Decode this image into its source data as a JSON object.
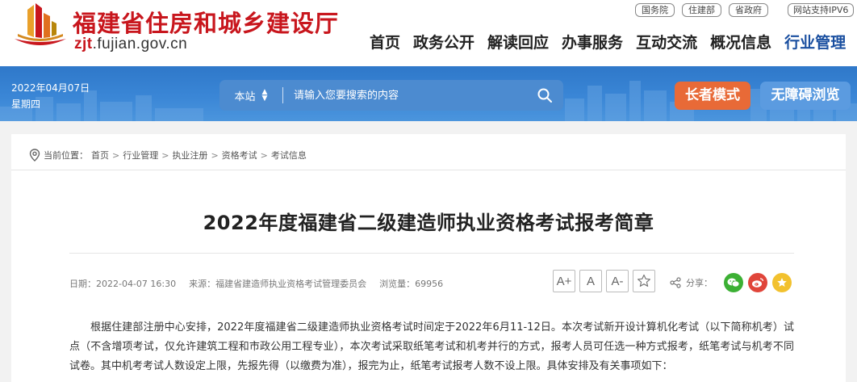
{
  "header": {
    "site_title": "福建省住房和城乡建设厅",
    "domain_prefix": "zjt",
    "domain_suffix": ".fujian.gov.cn",
    "top_links": [
      "国务院",
      "住建部",
      "省政府"
    ],
    "ipv6_badge": "网站支持IPV6",
    "nav": [
      "首页",
      "政务公开",
      "解读回应",
      "办事服务",
      "互动交流",
      "概况信息",
      "行业管理"
    ],
    "active_nav": "行业管理"
  },
  "banner": {
    "date": "2022年04月07日",
    "weekday": "星期四",
    "search_scope": "本站",
    "search_placeholder": "请输入您要搜索的内容",
    "elder_mode": "长者模式",
    "accessible_mode": "无障碍浏览"
  },
  "breadcrumb": {
    "prefix": "当前位置：",
    "items": [
      "首页",
      "行业管理",
      "执业注册",
      "资格考试",
      "考试信息"
    ],
    "separator": ">"
  },
  "article": {
    "title": "2022年度福建省二级建造师执业资格考试报考简章",
    "date": "日期：2022-04-07 16:30",
    "source": "来源：福建省建造师执业资格考试管理委员会",
    "views": "浏览量：69956",
    "font_larger": "A+",
    "font_normal": "A",
    "font_smaller": "A-",
    "share_label": "分享：",
    "body": "根据住建部注册中心安排，2022年度福建省二级建造师执业资格考试时间定于2022年6月11-12日。本次考试新开设计算机化考试（以下简称机考）试点（不含增项考试，仅允许建筑工程和市政公用工程专业），本次考试采取纸笔考试和机考并行的方式，报考人员可任选一种方式报考，纸笔考试与机考不同试卷。其中机考考试人数设定上限，先报先得（以缴费为准），报完为止，纸笔考试报考人数不设上限。具体安排及有关事项如下："
  },
  "colors": {
    "brand_red": "#c8161d",
    "nav_active": "#1a4fa0",
    "banner_blue": "#3a86d6",
    "elder_orange": "#e86a37",
    "accessible_blue": "#5b9be0",
    "wechat_green": "#3cb034",
    "weibo_red": "#e0453a",
    "favorite_yellow": "#f2c12e"
  },
  "icons": {
    "logo": "building-logo-icon",
    "search": "search-icon",
    "location": "location-pin-icon",
    "favorite": "star-outline-icon",
    "share": "share-icon",
    "wechat": "wechat-icon",
    "weibo": "weibo-icon",
    "collect": "star-icon"
  }
}
